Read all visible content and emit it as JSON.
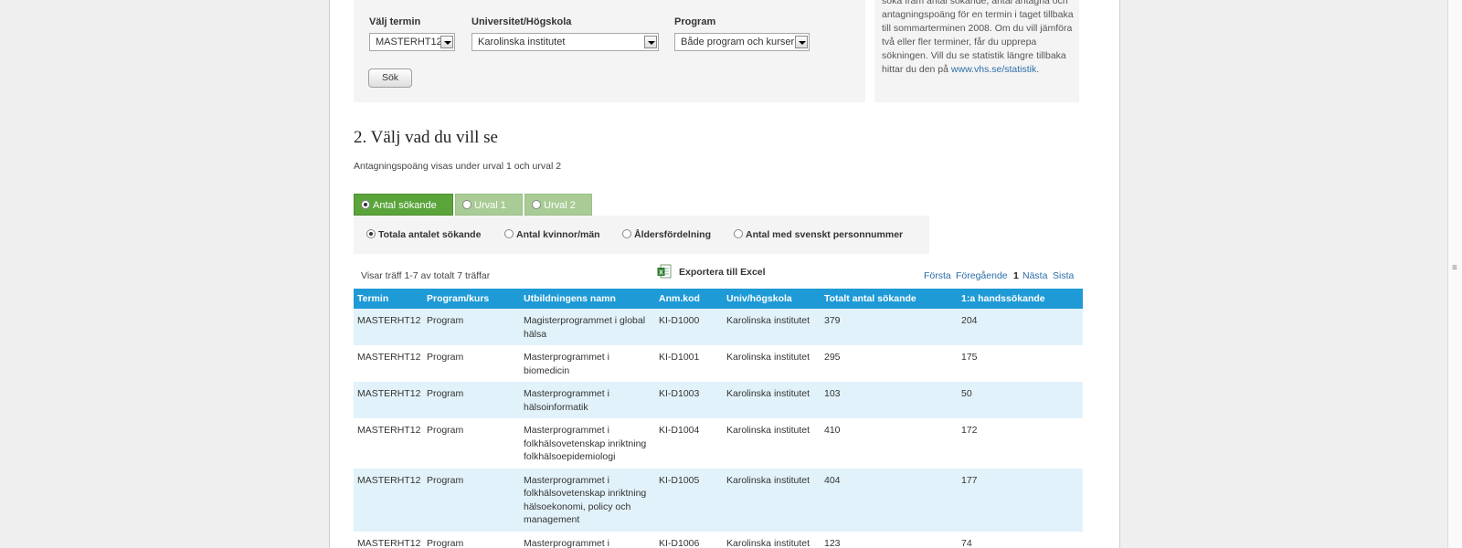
{
  "search_panel": {
    "term_label": "Välj termin",
    "term_value": "MASTERHT12",
    "university_label": "Universitet/Högskola",
    "university_value": "Karolinska institutet",
    "program_label": "Program",
    "program_value": "Både program och kurser",
    "search_button": "Sök"
  },
  "info_panel": {
    "text": "söka fram antal sökande, antal antagna och antagningspoäng för en termin i taget tillbaka till sommarterminen 2008. Om du vill jämföra två eller fler terminer, får du upprepa sökningen. Vill du se statistik längre tillbaka hittar du den på",
    "link": "www.vhs.se/statistik",
    "trailing": "."
  },
  "section": {
    "title": "2. Välj vad du vill se",
    "subtext": "Antagningspoäng visas under urval 1 och urval 2"
  },
  "tabs": [
    {
      "label": "Antal sökande",
      "active": true
    },
    {
      "label": "Urval 1",
      "active": false
    },
    {
      "label": "Urval 2",
      "active": false
    }
  ],
  "options": [
    {
      "label": "Totala antalet sökande",
      "selected": true
    },
    {
      "label": "Antal kvinnor/män",
      "selected": false
    },
    {
      "label": "Åldersfördelning",
      "selected": false
    },
    {
      "label": "Antal med svenskt personnummer",
      "selected": false
    }
  ],
  "results": {
    "info": "Visar träff 1-7 av totalt 7 träffar",
    "export_label": "Exportera till Excel",
    "pager": {
      "first": "Första",
      "previous": "Föregående",
      "current": "1",
      "next": "Nästa",
      "last": "Sista"
    }
  },
  "table": {
    "headers": [
      "Termin",
      "Program/kurs",
      "Utbildningens namn",
      "Anm.kod",
      "Univ/högskola",
      "Totalt antal sökande",
      "1:a handssökande"
    ],
    "rows": [
      [
        "MASTERHT12",
        "Program",
        "Magisterprogrammet i global hälsa",
        "KI-D1000",
        "Karolinska institutet",
        "379",
        "204"
      ],
      [
        "MASTERHT12",
        "Program",
        "Masterprogrammet i biomedicin",
        "KI-D1001",
        "Karolinska institutet",
        "295",
        "175"
      ],
      [
        "MASTERHT12",
        "Program",
        "Masterprogrammet i hälsoinformatik",
        "KI-D1003",
        "Karolinska institutet",
        "103",
        "50"
      ],
      [
        "MASTERHT12",
        "Program",
        "Masterprogrammet i folkhälsovetenskap inriktning folkhälsoepidemiologi",
        "KI-D1004",
        "Karolinska institutet",
        "410",
        "172"
      ],
      [
        "MASTERHT12",
        "Program",
        "Masterprogrammet i folkhälsovetenskap inriktning hälsoekonomi, policy och management",
        "KI-D1005",
        "Karolinska institutet",
        "404",
        "177"
      ],
      [
        "MASTERHT12",
        "Program",
        "Masterprogrammet i",
        "KI-D1006",
        "Karolinska institutet",
        "123",
        "74"
      ]
    ]
  },
  "colors": {
    "tab_active": "#5aa43a",
    "tab_inactive": "#a9cc96",
    "table_header": "#1e9ad6",
    "row_stripe": "#e2f2fa",
    "link": "#2a6fa8"
  }
}
